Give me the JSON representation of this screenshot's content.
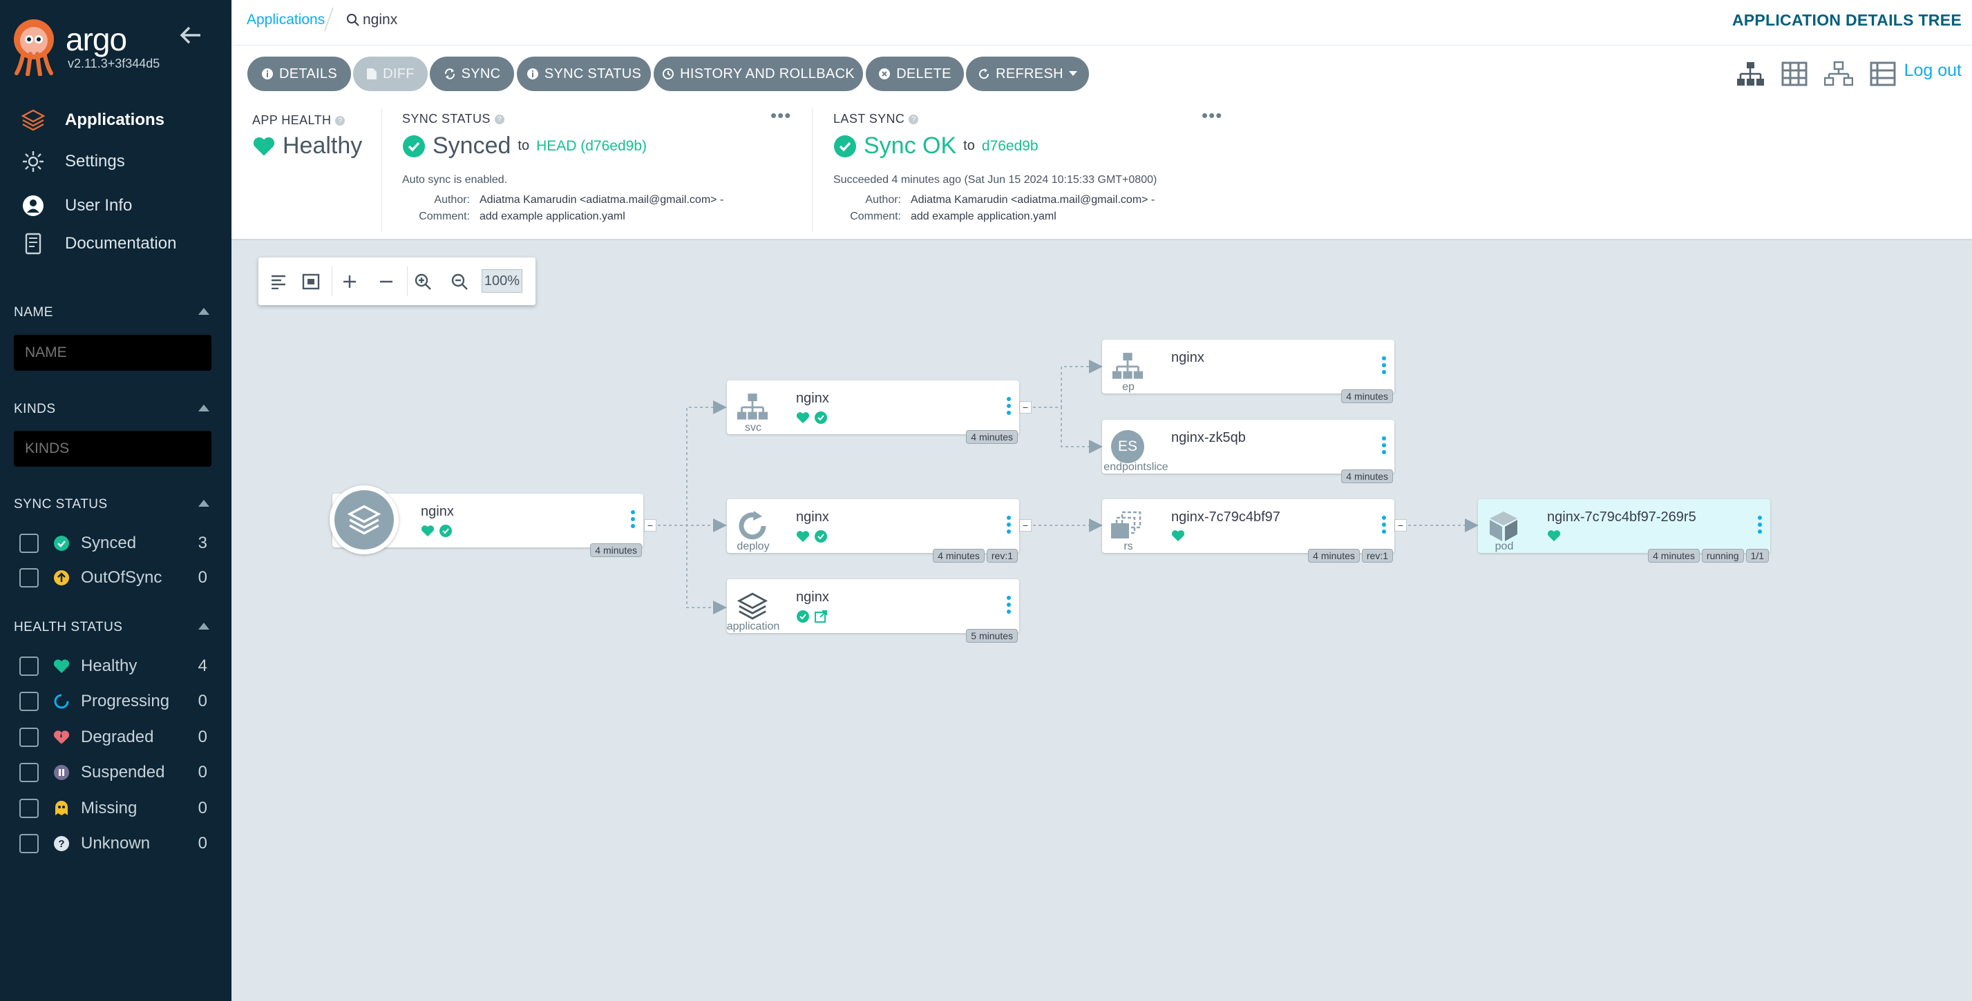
{
  "app": {
    "brand": "argo",
    "version": "v2.11.3+3f344d5"
  },
  "nav": [
    {
      "label": "Applications",
      "icon": "layers-icon"
    },
    {
      "label": "Settings",
      "icon": "gear-icon"
    },
    {
      "label": "User Info",
      "icon": "user-icon"
    },
    {
      "label": "Documentation",
      "icon": "book-icon"
    }
  ],
  "filters": {
    "name": {
      "title": "NAME",
      "placeholder": "NAME"
    },
    "kinds": {
      "title": "KINDS",
      "placeholder": "KINDS"
    },
    "sync": {
      "title": "SYNC STATUS",
      "items": [
        {
          "label": "Synced",
          "count": "3"
        },
        {
          "label": "OutOfSync",
          "count": "0"
        }
      ]
    },
    "health": {
      "title": "HEALTH STATUS",
      "items": [
        {
          "label": "Healthy",
          "count": "4"
        },
        {
          "label": "Progressing",
          "count": "0"
        },
        {
          "label": "Degraded",
          "count": "0"
        },
        {
          "label": "Suspended",
          "count": "0"
        },
        {
          "label": "Missing",
          "count": "0"
        },
        {
          "label": "Unknown",
          "count": "0"
        }
      ]
    }
  },
  "breadcrumb": {
    "root": "Applications",
    "current": "nginx"
  },
  "page_title": "APPLICATION DETAILS TREE",
  "toolbar": {
    "details": "DETAILS",
    "diff": "DIFF",
    "sync": "SYNC",
    "sync_status": "SYNC STATUS",
    "history": "HISTORY AND ROLLBACK",
    "delete": "DELETE",
    "refresh": "REFRESH",
    "logout": "Log out"
  },
  "summary": {
    "health": {
      "title": "APP HEALTH",
      "value": "Healthy"
    },
    "sync": {
      "title": "SYNC STATUS",
      "value": "Synced",
      "to": "to",
      "revision": "HEAD (d76ed9b)",
      "auto": "Auto sync is enabled.",
      "author_label": "Author:",
      "author": "Adiatma Kamarudin <adiatma.mail@gmail.com> -",
      "comment_label": "Comment:",
      "comment": "add example application.yaml"
    },
    "last": {
      "title": "LAST SYNC",
      "value": "Sync OK",
      "to": "to",
      "revision": "d76ed9b",
      "succeeded": "Succeeded 4 minutes ago (Sat Jun 15 2024 10:15:33 GMT+0800)",
      "author_label": "Author:",
      "author": "Adiatma Kamarudin <adiatma.mail@gmail.com> -",
      "comment_label": "Comment:",
      "comment": "add example application.yaml"
    }
  },
  "zoom": {
    "level": "100%"
  },
  "tree": {
    "root": {
      "name": "nginx",
      "age": "4 minutes"
    },
    "svc": {
      "name": "nginx",
      "kind": "svc",
      "age": "4 minutes"
    },
    "ep": {
      "name": "nginx",
      "kind": "ep",
      "age": "4 minutes"
    },
    "eps": {
      "name": "nginx-zk5qb",
      "kind": "endpointslice",
      "age": "4 minutes",
      "badge": "ES"
    },
    "deploy": {
      "name": "nginx",
      "kind": "deploy",
      "age": "4 minutes",
      "rev": "rev:1"
    },
    "rs": {
      "name": "nginx-7c79c4bf97",
      "kind": "rs",
      "age": "4 minutes",
      "rev": "rev:1"
    },
    "pod": {
      "name": "nginx-7c79c4bf97-269r5",
      "kind": "pod",
      "age": "4 minutes",
      "status": "running",
      "ready": "1/1"
    },
    "application": {
      "name": "nginx",
      "kind": "application",
      "age": "5 minutes"
    }
  },
  "colors": {
    "sidebar": "#0d2535",
    "healthy": "#18be94",
    "accent": "#0dadea",
    "canvas": "#dee6eb"
  }
}
